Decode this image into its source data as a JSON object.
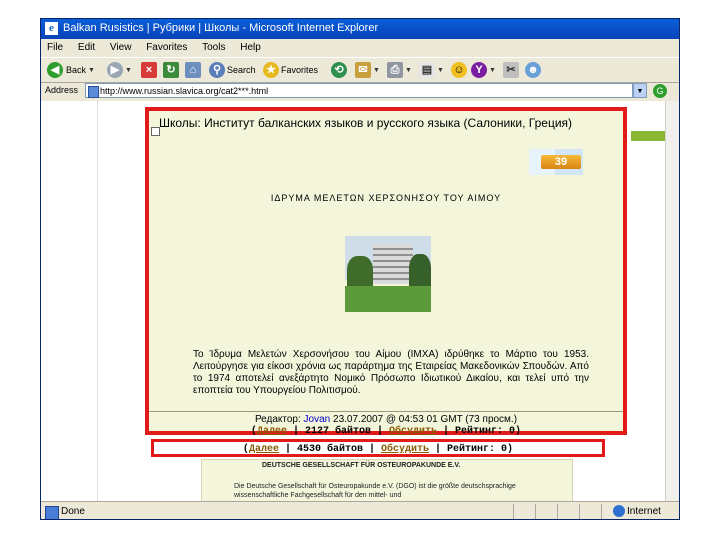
{
  "window": {
    "title": "Balkan Rusistics | Рубрики | Школы - Microsoft Internet Explorer"
  },
  "menu": [
    "File",
    "Edit",
    "View",
    "Favorites",
    "Tools",
    "Help"
  ],
  "toolbar": {
    "back": "Back",
    "search": "Search",
    "favorites": "Favorites"
  },
  "address": {
    "label": "Address",
    "url": "http://www.russian.slavica.org/cat2***.html",
    "go": "G"
  },
  "status": {
    "text": "Done",
    "zone": "Internet"
  },
  "article": {
    "title": "Школы: Институт балканских языков и русского языка (Салоники, Греция)",
    "badge": "39",
    "greek_heading": "ΙΔΡΥΜΑ ΜΕΛΕΤΩΝ ΧΕΡΣΟΝΗΣΟΥ ΤΟΥ ΑΙΜΟΥ",
    "paragraph": "Το Ίδρυμα Μελετών Χερσονήσου του Αίμου (ΙΜΧΑ) ιδρύθηκε το Μάρτιο του 1953. Λειτούργησε για είκοσι χρόνια ως παράρτημα της Εταιρείας Μακεδονικών Σπουδών. Από το 1974 αποτελεί ανεξάρτητο Νομικό Πρόσωπο Ιδιωτικού Δικαίου, και τελεί υπό την εποπτεία του Υπουργείου Πολιτισμού.",
    "editor_label": "Редактор:",
    "editor_name": "Jovan",
    "editor_when": "23.07.2007 @ 04:53 01 GMT (73 просм.)",
    "more": "Далее",
    "size": "2127 байтов",
    "discuss": "Обсудить",
    "rating": "Рейтинг: 0"
  },
  "second_entry": {
    "more": "Далее",
    "size": "4530 байтов",
    "discuss": "Обсудить",
    "rating": "Рейтинг: 0"
  },
  "background_entry": {
    "heading": "DEUTSCHE GESELLSCHAFT FÜR OSTEUROPAKUNDE E.V.",
    "text": "Die Deutsche Gesellschaft für Osteuropakunde e.V. (DGO) ist die größte deutschsprachige wissenschaftliche Fachgesellschaft für den mittel- und"
  },
  "colors": {
    "highlight": "#e11a1a",
    "panel_bg": "#f4f6dc",
    "link": "#8a5a00"
  }
}
